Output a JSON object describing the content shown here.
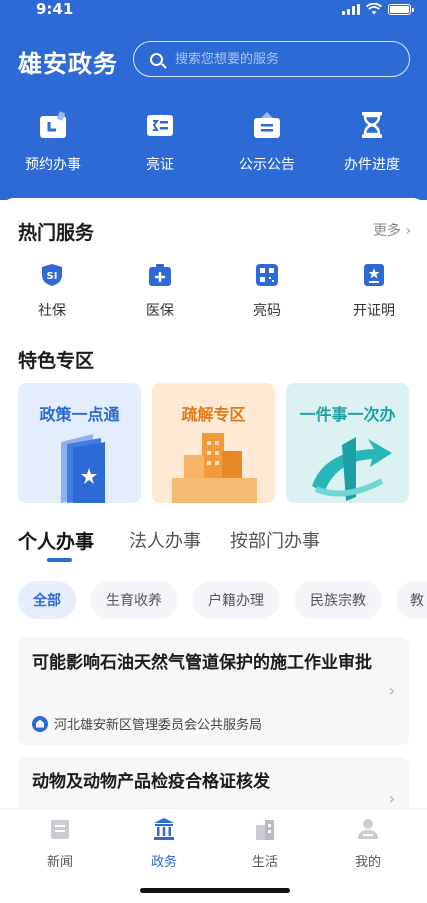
{
  "status_bar": {
    "time": "9:41"
  },
  "header": {
    "app_title": "雄安政务",
    "search_placeholder": "搜索您想要的服务",
    "quick_actions": [
      {
        "label": "预约办事",
        "icon": "calendar-icon"
      },
      {
        "label": "亮证",
        "icon": "id-card-icon"
      },
      {
        "label": "公示公告",
        "icon": "notice-board-icon"
      },
      {
        "label": "办件进度",
        "icon": "hourglass-icon"
      }
    ]
  },
  "hot_services": {
    "title": "热门服务",
    "more_label": "更多 ›",
    "items": [
      {
        "label": "社保",
        "icon": "social-security-icon"
      },
      {
        "label": "医保",
        "icon": "medical-insurance-icon"
      },
      {
        "label": "亮码",
        "icon": "qr-code-icon"
      },
      {
        "label": "开证明",
        "icon": "certificate-icon"
      }
    ]
  },
  "featured": {
    "title": "特色专区",
    "cards": [
      {
        "label": "政策一点通",
        "color": "#2d6ad6",
        "bg": "#e3edfb"
      },
      {
        "label": "疏解专区",
        "color": "#e07b1a",
        "bg": "#fde9d4"
      },
      {
        "label": "一件事一次办",
        "color": "#1c9fa5",
        "bg": "#dcf2f2"
      }
    ]
  },
  "tabs": [
    {
      "label": "个人办事",
      "active": true
    },
    {
      "label": "法人办事",
      "active": false
    },
    {
      "label": "按部门办事",
      "active": false
    }
  ],
  "filters": [
    {
      "label": "全部",
      "active": true
    },
    {
      "label": "生育收养",
      "active": false
    },
    {
      "label": "户籍办理",
      "active": false
    },
    {
      "label": "民族宗教",
      "active": false
    },
    {
      "label": "教",
      "active": false
    }
  ],
  "items": [
    {
      "title": "可能影响石油天然气管道保护的施工作业审批",
      "department": "河北雄安新区管理委员会公共服务局"
    },
    {
      "title": "动物及动物产品检疫合格证核发",
      "department": ""
    }
  ],
  "bottom_nav": [
    {
      "label": "新闻",
      "icon": "news-icon",
      "active": false
    },
    {
      "label": "政务",
      "icon": "government-icon",
      "active": true
    },
    {
      "label": "生活",
      "icon": "life-icon",
      "active": false
    },
    {
      "label": "我的",
      "icon": "profile-icon",
      "active": false
    }
  ],
  "colors": {
    "primary": "#2d6ad6",
    "orange": "#e07b1a",
    "teal": "#1c9fa5"
  }
}
